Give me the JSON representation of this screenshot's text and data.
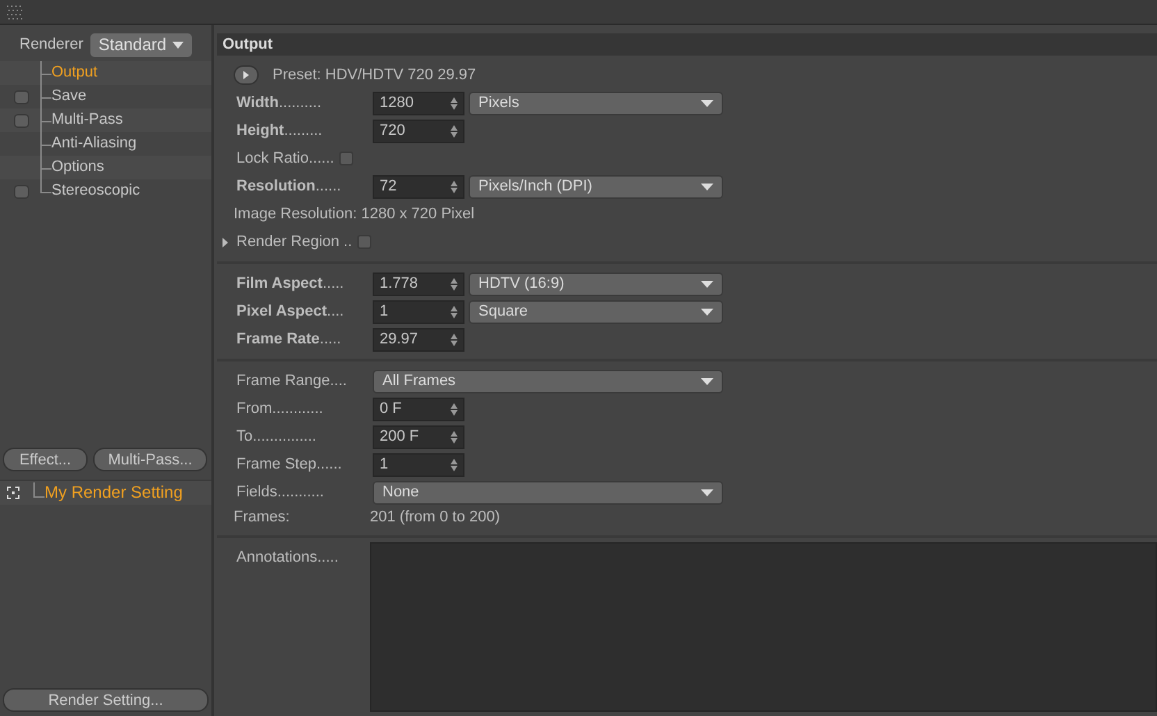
{
  "renderer": {
    "label": "Renderer",
    "value": "Standard"
  },
  "tree": [
    {
      "label": "Output",
      "selected": true
    },
    {
      "label": "Save",
      "selected": false,
      "checked": false
    },
    {
      "label": "Multi-Pass",
      "selected": false,
      "checked": false
    },
    {
      "label": "Anti-Aliasing",
      "selected": false
    },
    {
      "label": "Options",
      "selected": false
    },
    {
      "label": "Stereoscopic",
      "selected": false,
      "checked": false
    }
  ],
  "left_buttons": [
    "Effect...",
    "Multi-Pass..."
  ],
  "settings_list": [
    {
      "label": "My Render Setting",
      "selected": true
    }
  ],
  "bottom_button": "Render Setting...",
  "panel": {
    "title": "Output",
    "sections": [
      [
        {
          "kind": "preset",
          "text": "Preset: HDV/HDTV 720 29.97"
        },
        {
          "kind": "number",
          "label": "**Width**..........",
          "value": "1280",
          "unit": "Pixels"
        },
        {
          "kind": "number",
          "label": "**Height**.........",
          "value": "720"
        },
        {
          "kind": "checkbox",
          "label": "Lock Ratio......",
          "checked": false
        },
        {
          "kind": "number",
          "label": "**Resolution**......",
          "value": "72",
          "unit": "Pixels/Inch (DPI)"
        },
        {
          "kind": "info",
          "label": "Image Resolution: 1280 x 720 Pixel"
        },
        {
          "kind": "region",
          "label": "Render Region ..",
          "checked": false
        }
      ],
      [
        {
          "kind": "number",
          "label": "**Film Aspect**.....",
          "value": "1.778",
          "unit": "HDTV (16:9)"
        },
        {
          "kind": "number",
          "label": "**Pixel Aspect**....",
          "value": "1",
          "unit": "Square"
        },
        {
          "kind": "number",
          "label": "**Frame Rate**.....",
          "value": "29.97"
        }
      ],
      [
        {
          "kind": "dropdown",
          "label": "Frame Range....",
          "value": "All Frames"
        },
        {
          "kind": "number",
          "label": "From............",
          "value": "0 F"
        },
        {
          "kind": "number",
          "label": "To...............",
          "value": "200 F"
        },
        {
          "kind": "number",
          "label": "Frame Step......",
          "value": "1"
        },
        {
          "kind": "dropdown",
          "label": "Fields...........",
          "value": "None"
        },
        {
          "kind": "info2",
          "label": "Frames:",
          "value": "201 (from 0 to 200)"
        }
      ],
      [
        {
          "kind": "textarea",
          "label": "Annotations....."
        }
      ]
    ]
  }
}
